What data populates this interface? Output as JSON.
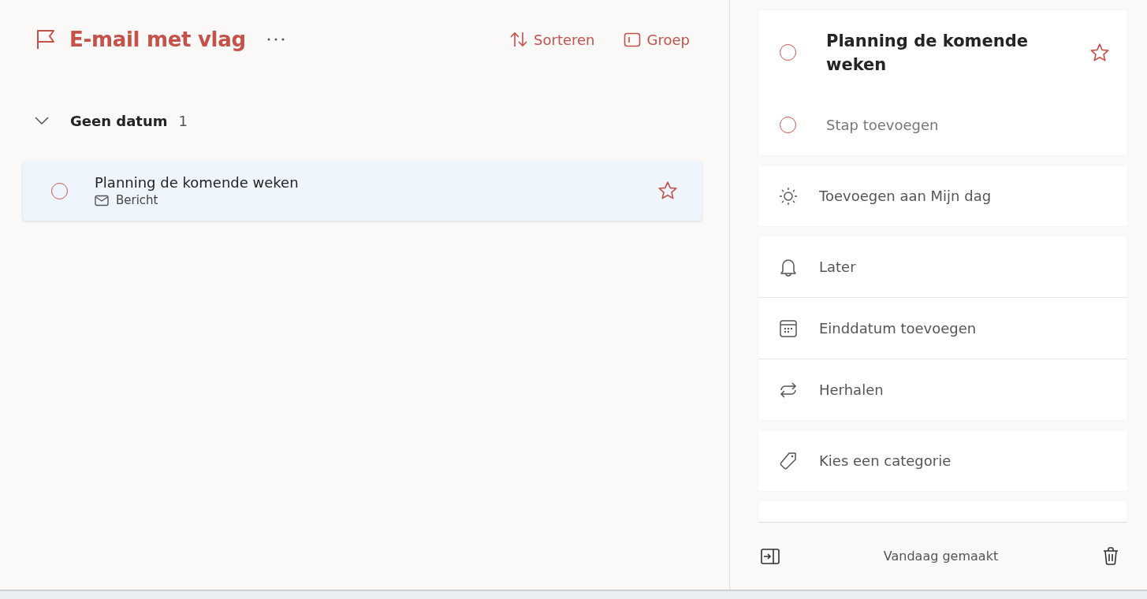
{
  "header": {
    "title": "E-mail met vlag",
    "actions": [
      {
        "kind": "sort",
        "label": "Sorteren"
      },
      {
        "kind": "group",
        "label": "Groep"
      }
    ]
  },
  "group": {
    "title": "Geen datum",
    "count": "1",
    "expanded": true
  },
  "tasks": [
    {
      "title": "Planning de komende weken",
      "source": "Bericht",
      "completed": false,
      "important": false,
      "selected": true
    }
  ],
  "detail": {
    "title": "Planning de komende weken",
    "completed": false,
    "important": false,
    "step_input": {
      "placeholder": "Stap toevoegen",
      "completed": false
    },
    "sections": [
      [
        {
          "kind": "sun",
          "label": "Toevoegen aan Mijn dag"
        }
      ],
      [
        {
          "kind": "bell",
          "label": "Later"
        },
        {
          "kind": "calendar",
          "label": "Einddatum toevoegen"
        },
        {
          "kind": "repeat",
          "label": "Herhalen"
        }
      ],
      [
        {
          "kind": "tag",
          "label": "Kies een categorie"
        }
      ]
    ],
    "footer": {
      "created": "Vandaag gemaakt"
    }
  }
}
